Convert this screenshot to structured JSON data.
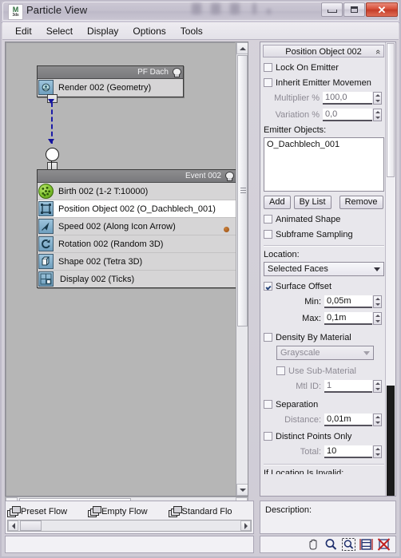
{
  "window": {
    "title": "Particle View",
    "app_icon": "3dsmax-icon",
    "buttons": {
      "minimize": "minimize-icon",
      "maximize": "maximize-icon",
      "close": "✕"
    }
  },
  "menu": {
    "items": [
      "Edit",
      "Select",
      "Display",
      "Options",
      "Tools"
    ]
  },
  "canvas": {
    "flow_node": {
      "title": "PF Dach",
      "operators": [
        {
          "label": "Render 002 (Geometry)",
          "icon": "render-icon",
          "selected": false
        }
      ]
    },
    "event_node": {
      "title": "Event 002",
      "operators": [
        {
          "label": "Birth 002 (1-2 T:10000)",
          "icon": "birth-icon",
          "selected": false
        },
        {
          "label": "Position Object 002 (O_Dachblech_001)",
          "icon": "position-object-icon",
          "selected": true
        },
        {
          "label": "Speed 002 (Along Icon Arrow)",
          "icon": "speed-icon",
          "selected": false
        },
        {
          "label": "Rotation 002 (Random 3D)",
          "icon": "rotation-icon",
          "selected": false
        },
        {
          "label": "Shape 002 (Tetra 3D)",
          "icon": "shape-icon",
          "selected": false
        },
        {
          "label": "Display 002 (Ticks)",
          "icon": "display-icon",
          "selected": false
        }
      ]
    }
  },
  "depot": {
    "items": [
      {
        "label": "Preset Flow",
        "icon": "flow-icon"
      },
      {
        "label": "Empty Flow",
        "icon": "flow-icon"
      },
      {
        "label": "Standard Flo",
        "icon": "flow-icon"
      }
    ]
  },
  "params": {
    "rollout_title": "Position Object 002",
    "collapse_glyph": "«",
    "lock_on_emitter": {
      "label": "Lock On Emitter",
      "checked": false
    },
    "inherit_emitter_movement": {
      "label": "Inherit Emitter Movemen",
      "checked": false
    },
    "multiplier": {
      "label": "Multiplier %",
      "value": "100,0"
    },
    "variation": {
      "label": "Variation %",
      "value": "0,0"
    },
    "emitter_objects_label": "Emitter Objects:",
    "emitter_objects": [
      "O_Dachblech_001"
    ],
    "buttons": {
      "add": "Add",
      "by_list": "By List",
      "remove": "Remove"
    },
    "animated_shape": {
      "label": "Animated Shape",
      "checked": false
    },
    "subframe_sampling": {
      "label": "Subframe Sampling",
      "checked": false
    },
    "location_label": "Location:",
    "location_value": "Selected Faces",
    "surface_offset": {
      "label": "Surface Offset",
      "checked": true
    },
    "min": {
      "label": "Min:",
      "value": "0,05m"
    },
    "max": {
      "label": "Max:",
      "value": "0,1m"
    },
    "density_by_material": {
      "label": "Density By Material",
      "checked": false
    },
    "density_mode": "Grayscale",
    "use_sub_material": {
      "label": "Use Sub-Material",
      "checked": false
    },
    "mtl_id": {
      "label": "Mtl ID:",
      "value": "1"
    },
    "separation": {
      "label": "Separation",
      "checked": false
    },
    "distance": {
      "label": "Distance:",
      "value": "0,01m"
    },
    "distinct_points_only": {
      "label": "Distinct Points Only",
      "checked": false
    },
    "total": {
      "label": "Total:",
      "value": "10"
    },
    "clipped_label": "If Location Is Invalid:"
  },
  "description": {
    "label": "Description:"
  },
  "toolbar": {
    "icons": [
      "pan-hand-icon",
      "zoom-icon",
      "zoom-region-icon",
      "zoom-extents-icon",
      "no-zoom-icon"
    ]
  }
}
